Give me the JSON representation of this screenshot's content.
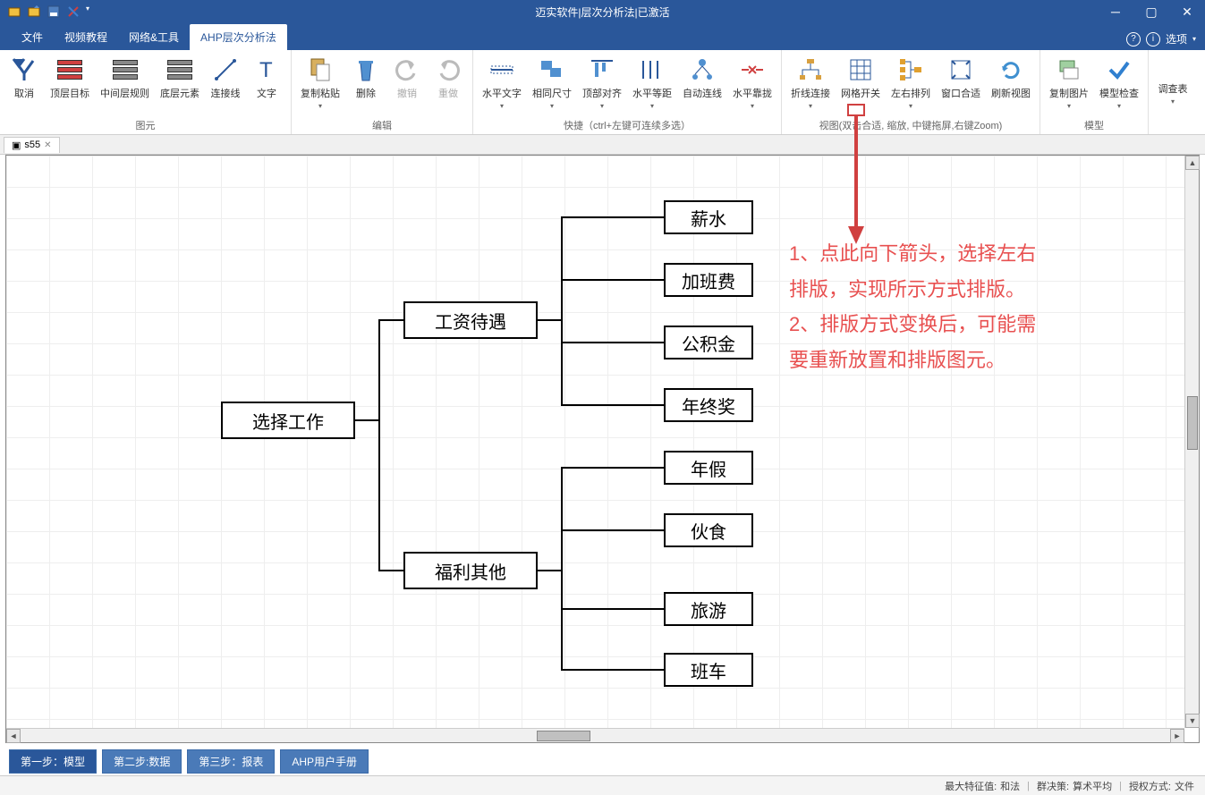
{
  "title": "迈实软件|层次分析法|已激活",
  "menutabs": {
    "t0": "文件",
    "t1": "视频教程",
    "t2": "网络&工具",
    "t3": "AHP层次分析法"
  },
  "options_label": "选项",
  "ribbon": {
    "g1_label": "图元",
    "cancel": "取消",
    "top": "顶层目标",
    "mid": "中间层规则",
    "bot": "底层元素",
    "conn": "连接线",
    "text": "文字",
    "g2_label": "编辑",
    "copy": "复制粘贴",
    "del": "删除",
    "undo": "撤销",
    "redo": "重做",
    "g3_label": "快捷（ctrl+左键可连续多选）",
    "htext": "水平文字",
    "samesize": "相同尺寸",
    "topalign": "顶部对齐",
    "hspace": "水平等距",
    "autoconn": "自动连线",
    "hsnap": "水平靠拢",
    "g4_label": "视图(双击合适,        缩放, 中键拖屏,右键Zoom)",
    "foldconn": "折线连接",
    "grid": "网格开关",
    "lrarrange": "左右排列",
    "fitwin": "窗口合适",
    "refresh": "刷新视图",
    "g5_label": "模型",
    "copypic": "复制图片",
    "check": "模型检查",
    "survey": "调查表"
  },
  "doctab": "s55",
  "nodes": {
    "root": "选择工作",
    "m1": "工资待遇",
    "m2": "福利其他",
    "c1": "薪水",
    "c2": "加班费",
    "c3": "公积金",
    "c4": "年终奖",
    "c5": "年假",
    "c6": "伙食",
    "c7": "旅游",
    "c8": "班车"
  },
  "annotation": {
    "l1": "1、点此向下箭头，选择左右",
    "l2": "排版，实现所示方式排版。",
    "l3": "2、排版方式变换后，可能需",
    "l4": "要重新放置和排版图元。"
  },
  "steps": {
    "s1": "第一步：模型",
    "s2": "第二步:数据",
    "s3": "第三步：报表",
    "s4": "AHP用户手册"
  },
  "status": {
    "eigen_k": "最大特征值:",
    "eigen_v": "和法",
    "group_k": "群决策:",
    "group_v": "算术平均",
    "auth_k": "授权方式:",
    "auth_v": "文件"
  }
}
